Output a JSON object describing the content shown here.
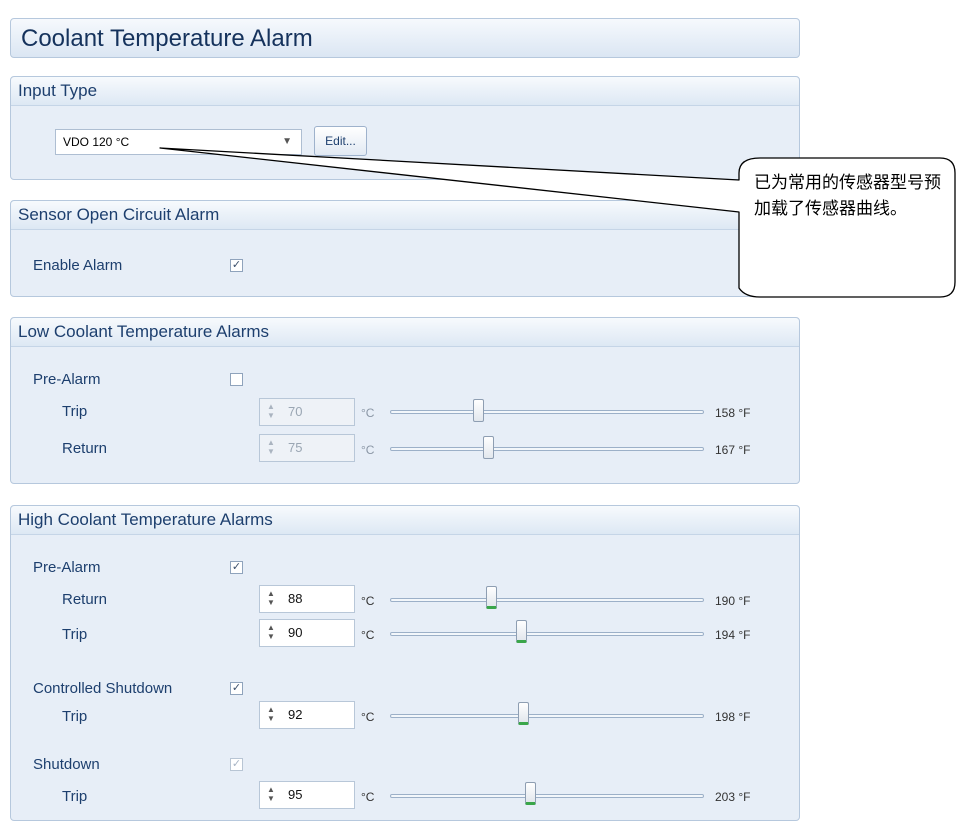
{
  "title": "Coolant Temperature Alarm",
  "input_type": {
    "header": "Input Type",
    "selected": "VDO 120 °C",
    "edit_label": "Edit..."
  },
  "sensor_open_circuit": {
    "header": "Sensor Open Circuit Alarm",
    "enable_label": "Enable Alarm",
    "enable_checked": true
  },
  "low_alarms": {
    "header": "Low Coolant Temperature Alarms",
    "pre_alarm_label": "Pre-Alarm",
    "pre_alarm_checked": false,
    "rows": [
      {
        "label": "Trip",
        "value": "70",
        "unit": "°C",
        "f_value": "158 °F"
      },
      {
        "label": "Return",
        "value": "75",
        "unit": "°C",
        "f_value": "167 °F"
      }
    ]
  },
  "high_alarms": {
    "header": "High Coolant Temperature Alarms",
    "pre_alarm_label": "Pre-Alarm",
    "pre_alarm_checked": true,
    "pre_rows": [
      {
        "label": "Return",
        "value": "88",
        "unit": "°C",
        "f_value": "190 °F"
      },
      {
        "label": "Trip",
        "value": "90",
        "unit": "°C",
        "f_value": "194 °F"
      }
    ],
    "controlled_shutdown_label": "Controlled Shutdown",
    "controlled_shutdown_checked": true,
    "cs_rows": [
      {
        "label": "Trip",
        "value": "92",
        "unit": "°C",
        "f_value": "198 °F"
      }
    ],
    "shutdown_label": "Shutdown",
    "shutdown_checked": true,
    "sd_rows": [
      {
        "label": "Trip",
        "value": "95",
        "unit": "°C",
        "f_value": "203 °F"
      }
    ]
  },
  "callout_text": "已为常用的传感器型号预加载了传感器曲线。",
  "colors": {
    "panel_bg": "#e7eef7",
    "header_text": "#1d3f6e",
    "slider_thumb_accent": "#3aa64a"
  },
  "icons": {
    "checkbox_checked": "✓",
    "dropdown": "chevron-down-icon",
    "spinner": "spinner-arrows-icon"
  }
}
